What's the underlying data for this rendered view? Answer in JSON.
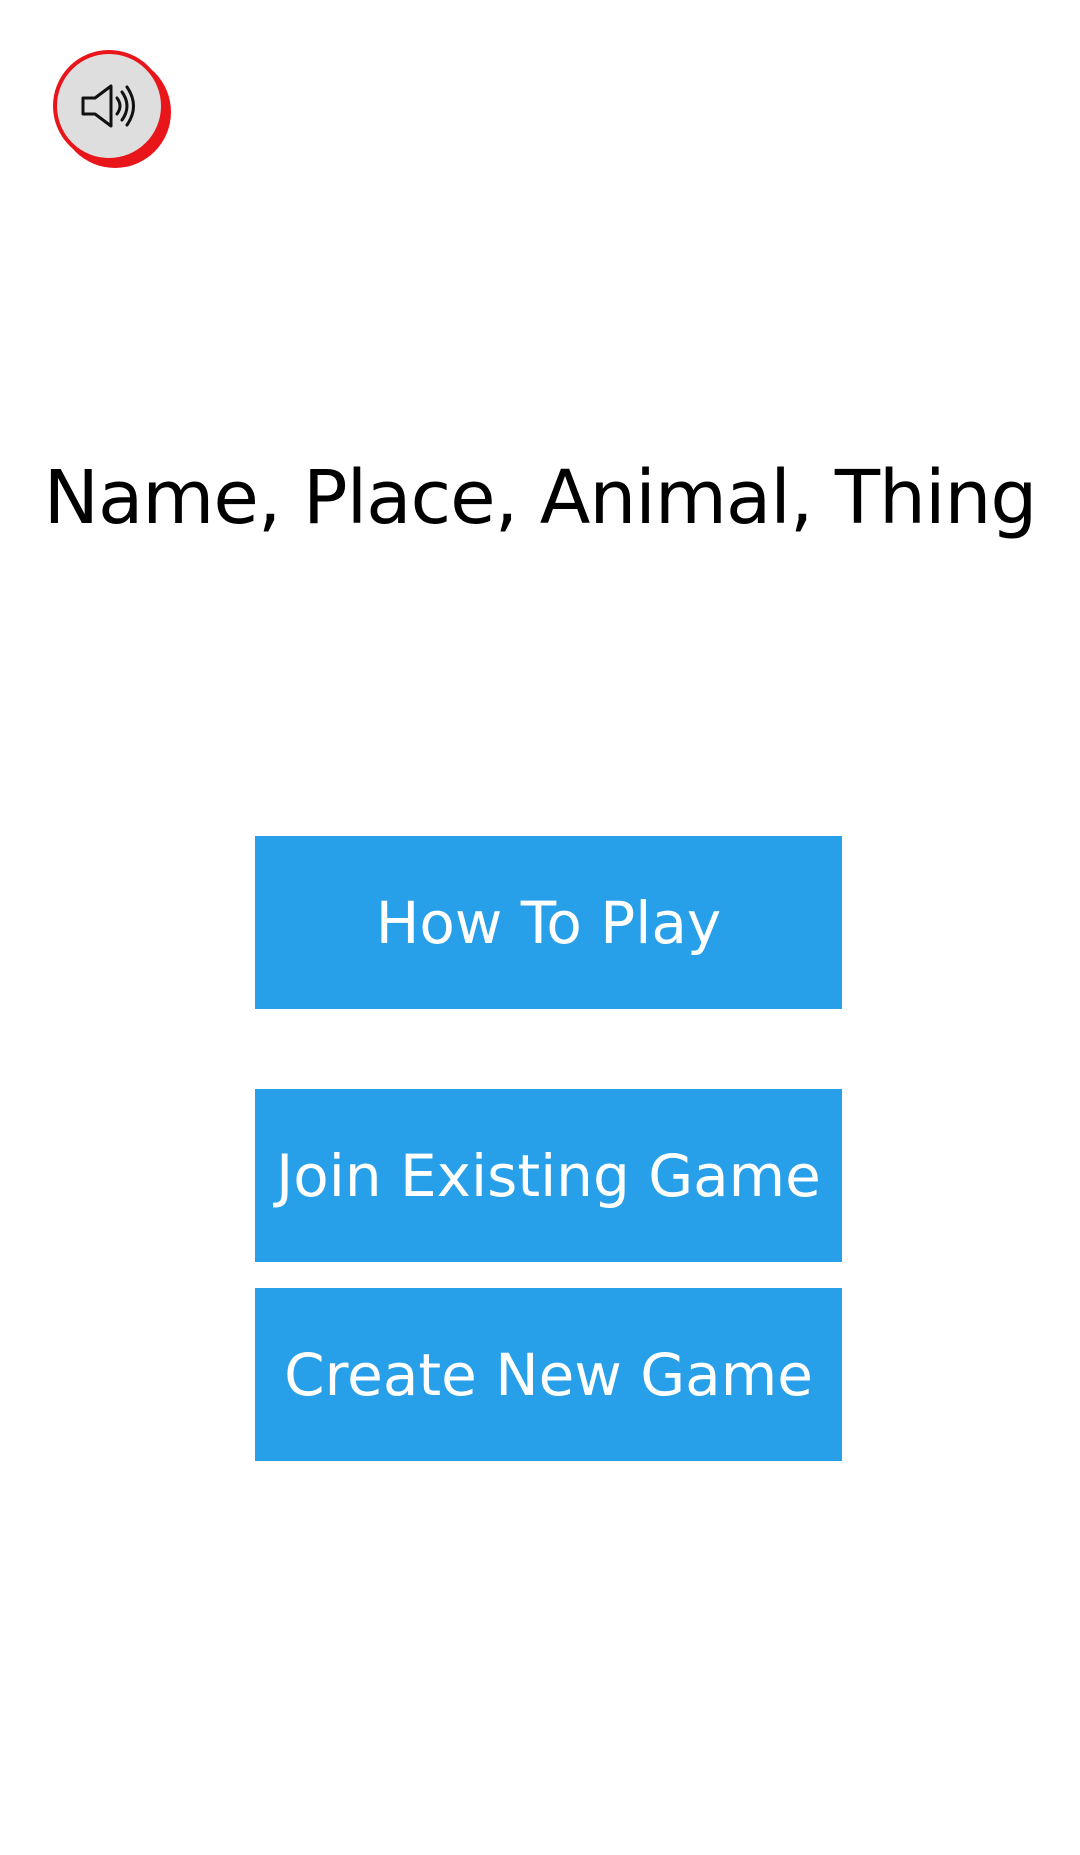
{
  "header": {
    "sound_icon": "speaker-icon",
    "sound_ring_color": "#e8161b",
    "sound_bg_color": "#dedede"
  },
  "main": {
    "title": "Name, Place, Animal, Thing",
    "buttons": [
      {
        "label": "How To Play"
      },
      {
        "label": "Join Existing Game"
      },
      {
        "label": "Create New Game"
      }
    ],
    "button_color": "#279fe9",
    "button_text_color": "#ffffff"
  }
}
